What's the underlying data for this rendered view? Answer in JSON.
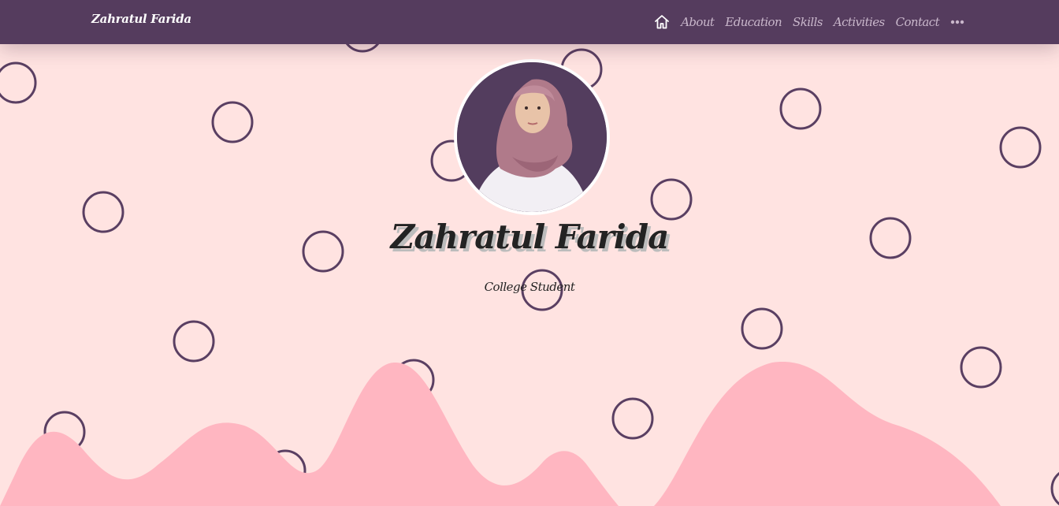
{
  "navbar": {
    "brand": "Zahratul Farida",
    "home_icon": "home-icon",
    "links": [
      "About",
      "Education",
      "Skills",
      "Activities",
      "Contact"
    ],
    "more_icon": "more-dots-icon"
  },
  "hero": {
    "name": "Zahratul Farida",
    "subtitle": "College Student",
    "avatar_alt": "profile-photo"
  },
  "colors": {
    "navbar": "#553c5e",
    "background": "#ffe3e1",
    "hills": "#ffb6c1",
    "circles": "#5a3f62",
    "nav_link": "#c9b7cb"
  }
}
